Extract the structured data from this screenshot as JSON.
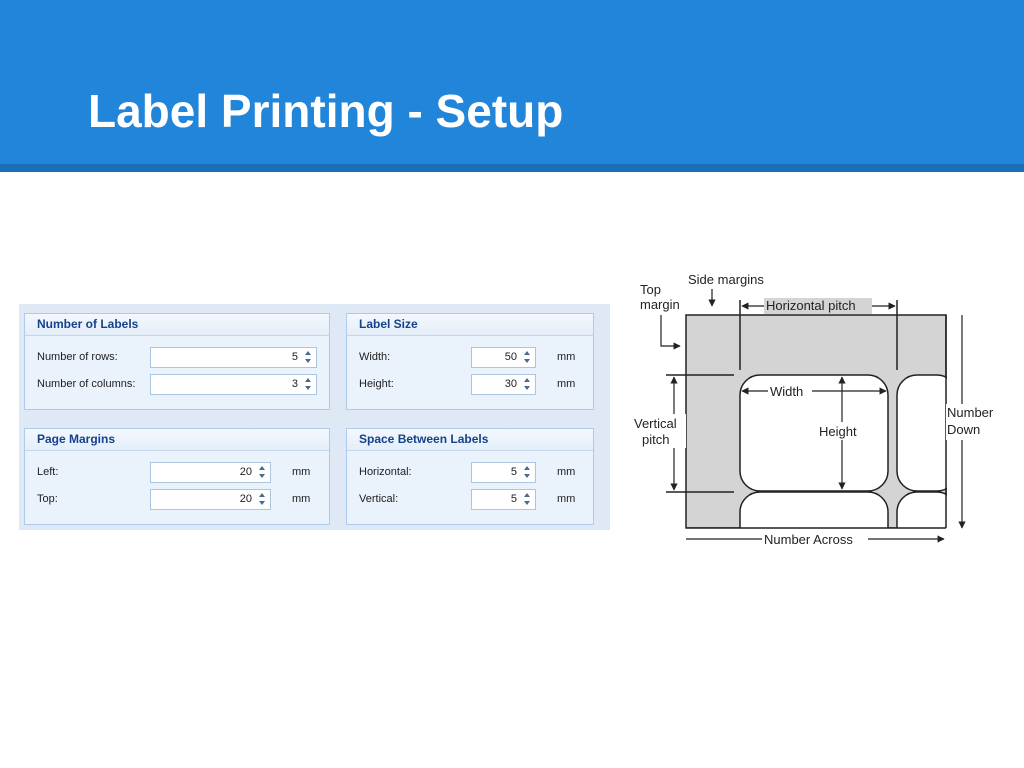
{
  "slide": {
    "title": "Label Printing - Setup"
  },
  "colors": {
    "banner": "#2185d9",
    "banner_rule": "#1b6fb8",
    "group_header_text": "#15428b",
    "label_sheet_fill": "#d4d4d4"
  },
  "groups": {
    "number_of_labels": {
      "header": "Number of Labels",
      "rows_label": "Number of rows:",
      "rows_value": "5",
      "cols_label": "Number of columns:",
      "cols_value": "3"
    },
    "label_size": {
      "header": "Label Size",
      "width_label": "Width:",
      "width_value": "50",
      "width_unit": "mm",
      "height_label": "Height:",
      "height_value": "30",
      "height_unit": "mm"
    },
    "page_margins": {
      "header": "Page Margins",
      "left_label": "Left:",
      "left_value": "20",
      "left_unit": "mm",
      "top_label": "Top:",
      "top_value": "20",
      "top_unit": "mm"
    },
    "space_between_labels": {
      "header": "Space Between Labels",
      "horizontal_label": "Horizontal:",
      "horizontal_value": "5",
      "horizontal_unit": "mm",
      "vertical_label": "Vertical:",
      "vertical_value": "5",
      "vertical_unit": "mm"
    }
  },
  "icons": {
    "spinner_up": "triangle-up",
    "spinner_down": "triangle-down"
  },
  "diagram": {
    "top_margin_1": "Top",
    "top_margin_2": "margin",
    "side_margins": "Side margins",
    "horizontal_pitch": "Horizontal pitch",
    "width": "Width",
    "height": "Height",
    "vertical_pitch_1": "Vertical",
    "vertical_pitch_2": "pitch",
    "number_down_1": "Number",
    "number_down_2": "Down",
    "number_across": "Number Across"
  }
}
